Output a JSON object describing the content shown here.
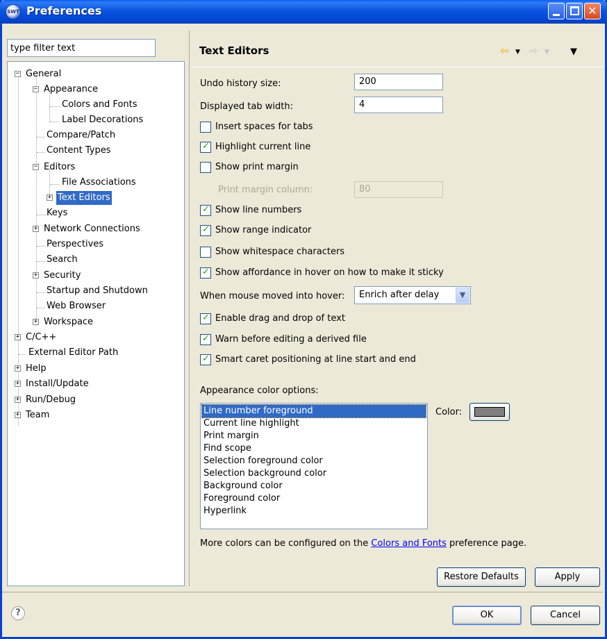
{
  "window": {
    "title": "Preferences",
    "icon_text": "SWT"
  },
  "filter": {
    "placeholder": "type filter text",
    "value": "type filter text"
  },
  "tree": {
    "general": "General",
    "appearance": "Appearance",
    "colors_and_fonts": "Colors and Fonts",
    "label_decorations": "Label Decorations",
    "compare_patch": "Compare/Patch",
    "content_types": "Content Types",
    "editors": "Editors",
    "file_associations": "File Associations",
    "text_editors": "Text Editors",
    "keys": "Keys",
    "network_connections": "Network Connections",
    "perspectives": "Perspectives",
    "search": "Search",
    "security": "Security",
    "startup_shutdown": "Startup and Shutdown",
    "web_browser": "Web Browser",
    "workspace": "Workspace",
    "cpp": "C/C++",
    "external_editor_path": "External Editor Path",
    "help": "Help",
    "install_update": "Install/Update",
    "run_debug": "Run/Debug",
    "team": "Team"
  },
  "page": {
    "title": "Text Editors",
    "undo_label": "Undo history size:",
    "undo_value": "200",
    "tab_width_label": "Displayed tab width:",
    "tab_width_value": "4",
    "insert_spaces": "Insert spaces for tabs",
    "highlight_line": "Highlight current line",
    "show_print_margin": "Show print margin",
    "print_margin_column_label": "Print margin column:",
    "print_margin_column_value": "80",
    "show_line_numbers": "Show line numbers",
    "show_range_indicator": "Show range indicator",
    "show_whitespace": "Show whitespace characters",
    "show_affordance": "Show affordance in hover on how to make it sticky",
    "hover_label": "When mouse moved into hover:",
    "hover_value": "Enrich after delay",
    "enable_dnd": "Enable drag and drop of text",
    "warn_derived": "Warn before editing a derived file",
    "smart_caret": "Smart caret positioning at line start and end",
    "appearance_label": "Appearance color options:",
    "color_items": [
      "Line number foreground",
      "Current line highlight",
      "Print margin",
      "Find scope",
      "Selection foreground color",
      "Selection background color",
      "Background color",
      "Foreground color",
      "Hyperlink"
    ],
    "color_label": "Color:",
    "swatch_color": "#7f7f7f",
    "note_prefix": "More colors can be configured on the ",
    "note_link": "Colors and Fonts",
    "note_suffix": " preference page."
  },
  "buttons": {
    "restore_defaults": "Restore Defaults",
    "apply": "Apply",
    "ok": "OK",
    "cancel": "Cancel"
  },
  "colors": {
    "selection": "#316ac5",
    "title_bar": "#0a55e0",
    "dialog_bg": "#ece9d8"
  }
}
